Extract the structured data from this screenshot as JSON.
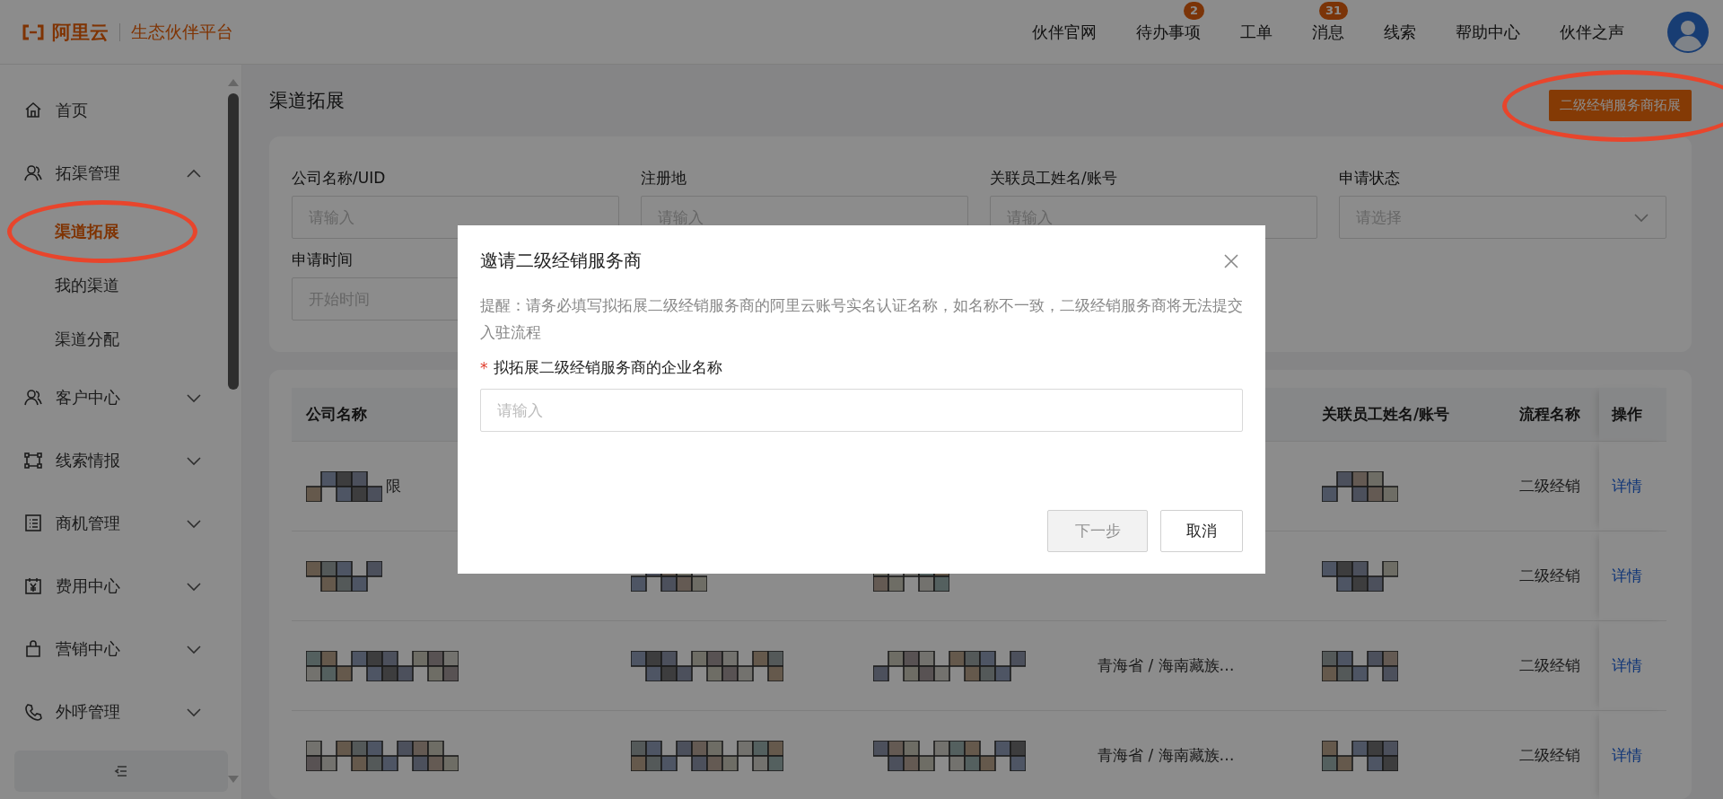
{
  "header": {
    "logo_text": "阿里云",
    "platform": "生态伙伴平台",
    "nav": [
      {
        "label": "伙伴官网"
      },
      {
        "label": "待办事项",
        "badge": "2"
      },
      {
        "label": "工单"
      },
      {
        "label": "消息",
        "badge": "31"
      },
      {
        "label": "线索"
      },
      {
        "label": "帮助中心"
      },
      {
        "label": "伙伴之声"
      }
    ]
  },
  "sidebar": {
    "items": [
      {
        "label": "首页"
      },
      {
        "label": "拓渠管理",
        "expanded": true,
        "children": [
          {
            "label": "渠道拓展",
            "selected": true,
            "circled": true
          },
          {
            "label": "我的渠道",
            "selected": false,
            "circled": false
          },
          {
            "label": "渠道分配",
            "selected": false,
            "circled": false
          }
        ]
      },
      {
        "label": "客户中心",
        "expanded": false
      },
      {
        "label": "线索情报",
        "expanded": false
      },
      {
        "label": "商机管理",
        "expanded": false
      },
      {
        "label": "费用中心",
        "expanded": false
      },
      {
        "label": "营销中心",
        "expanded": false
      },
      {
        "label": "外呼管理",
        "expanded": false
      }
    ]
  },
  "page": {
    "title": "渠道拓展",
    "action": {
      "label": "二级经销服务商拓展",
      "circled": true
    }
  },
  "filters": [
    {
      "label": "公司名称/UID",
      "kind": "input",
      "placeholder": "请输入"
    },
    {
      "label": "注册地",
      "kind": "input",
      "placeholder": "请输入"
    },
    {
      "label": "关联员工姓名/账号",
      "kind": "input",
      "placeholder": "请输入"
    },
    {
      "label": "申请状态",
      "kind": "select",
      "placeholder": "请选择"
    },
    {
      "label": "申请时间",
      "kind": "daterange",
      "placeholder": "开始时间"
    }
  ],
  "table": {
    "columns": [
      {
        "label": "公司名称"
      },
      {},
      {},
      {},
      {
        "label": "关联员工姓名/账号"
      },
      {
        "label": "流程名称"
      },
      {
        "label": "操作"
      }
    ],
    "rows": [
      {
        "cells": [
          {
            "kind": "redacted",
            "text": "限"
          },
          {
            "kind": "none"
          },
          {
            "kind": "none"
          },
          {
            "kind": "none"
          },
          {
            "kind": "redacted"
          },
          {
            "kind": "text",
            "text": "二级经销"
          },
          {
            "kind": "link",
            "text": "详情"
          }
        ]
      },
      {
        "cells": [
          {
            "kind": "redacted"
          },
          {
            "kind": "redacted"
          },
          {
            "kind": "redacted"
          },
          {
            "kind": "none"
          },
          {
            "kind": "redacted"
          },
          {
            "kind": "text",
            "text": "二级经销"
          },
          {
            "kind": "link",
            "text": "详情"
          }
        ]
      },
      {
        "cells": [
          {
            "kind": "redacted"
          },
          {
            "kind": "redacted"
          },
          {
            "kind": "redacted"
          },
          {
            "kind": "text",
            "text": "青海省 / 海南藏族…"
          },
          {
            "kind": "redacted"
          },
          {
            "kind": "text",
            "text": "二级经销"
          },
          {
            "kind": "link",
            "text": "详情"
          }
        ]
      },
      {
        "cells": [
          {
            "kind": "redacted"
          },
          {
            "kind": "redacted"
          },
          {
            "kind": "redacted"
          },
          {
            "kind": "text",
            "text": "青海省 / 海南藏族…"
          },
          {
            "kind": "redacted"
          },
          {
            "kind": "text",
            "text": "二级经销"
          },
          {
            "kind": "link",
            "text": "详情"
          }
        ]
      }
    ]
  },
  "dialog": {
    "title": "邀请二级经销服务商",
    "notice": "提醒：请务必填写拟拓展二级经销服务商的阿里云账号实名认证名称，如名称不一致，二级经销服务商将无法提交入驻流程",
    "field": {
      "label": "拟拓展二级经销服务商的企业名称",
      "required": true,
      "required_mark": "*",
      "placeholder": "请输入"
    },
    "buttons": [
      {
        "label": "下一步",
        "disabled": true
      },
      {
        "label": "取消",
        "disabled": false
      }
    ]
  }
}
